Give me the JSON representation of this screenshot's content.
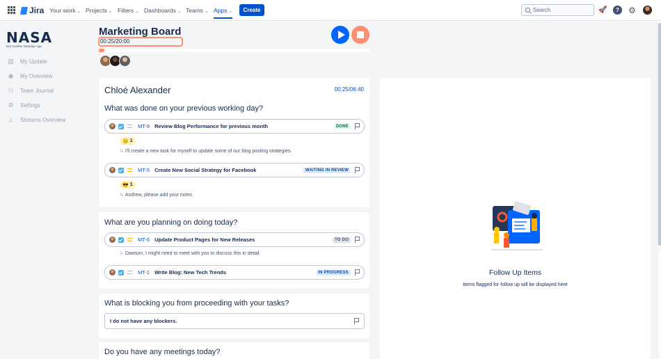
{
  "topnav": {
    "product": "Jira",
    "items": [
      {
        "label": "Your work"
      },
      {
        "label": "Projects"
      },
      {
        "label": "Filters"
      },
      {
        "label": "Dashboards"
      },
      {
        "label": "Teams"
      },
      {
        "label": "Apps"
      }
    ],
    "active_item": "Apps",
    "create_label": "Create",
    "search_placeholder": "Search",
    "icons": [
      "app-switcher-icon",
      "notifications-icon",
      "help-icon",
      "settings-icon",
      "profile-avatar"
    ],
    "accent_color": "#0052cc"
  },
  "sidebar": {
    "logo_text": "NASA",
    "logo_tagline": "Not Another Standup App",
    "items": [
      {
        "label": "My Update",
        "icon": "document-icon"
      },
      {
        "label": "My Overview",
        "icon": "person-icon"
      },
      {
        "label": "Team Journal",
        "icon": "team-icon"
      },
      {
        "label": "Settings",
        "icon": "gear-icon"
      },
      {
        "label": "Streams Overview",
        "icon": "hierarchy-icon"
      }
    ]
  },
  "board": {
    "title": "Marketing Board",
    "timer": "00:25/20:00",
    "progress_fraction": 0.021,
    "play_color": "#0065ff",
    "stop_color": "#ff8f73"
  },
  "person": {
    "name": "Chloé Alexander",
    "timer": "00:25/06:40"
  },
  "previous_day": {
    "question": "What was done on your previous working day?",
    "issues": [
      {
        "key": "MT-9",
        "summary": "Review Blog Performance for previous month",
        "status": "DONE",
        "reaction_emoji": "😊",
        "reaction_count": "1",
        "comment": "I'll create a new task for myself to update some of our blog posting strategies."
      },
      {
        "key": "MT-5",
        "summary": "Create New Social Strategy for Facebook",
        "status": "WAITING IN REVIEW",
        "reaction_emoji": "😎",
        "reaction_count": "1",
        "comment": "Andrew, please add your notes."
      }
    ]
  },
  "today": {
    "question": "What are you planning on doing today?",
    "issues": [
      {
        "key": "MT-6",
        "summary": "Update Product Pages for New Releases",
        "status": "TO DO",
        "comment": "Dawson, I might need to meet with you to discuss this in detail."
      },
      {
        "key": "MT-1",
        "summary": "Write Blog: New Tech Trends",
        "status": "IN PROGRESS"
      }
    ]
  },
  "blockers": {
    "question": "What is blocking you from proceeding with your tasks?",
    "answer": "I do not have any blockers."
  },
  "meetings": {
    "question": "Do you have any meetings today?"
  },
  "followup": {
    "title": "Follow Up Items",
    "subtitle": "Items flagged for follow up will be displayed here"
  }
}
